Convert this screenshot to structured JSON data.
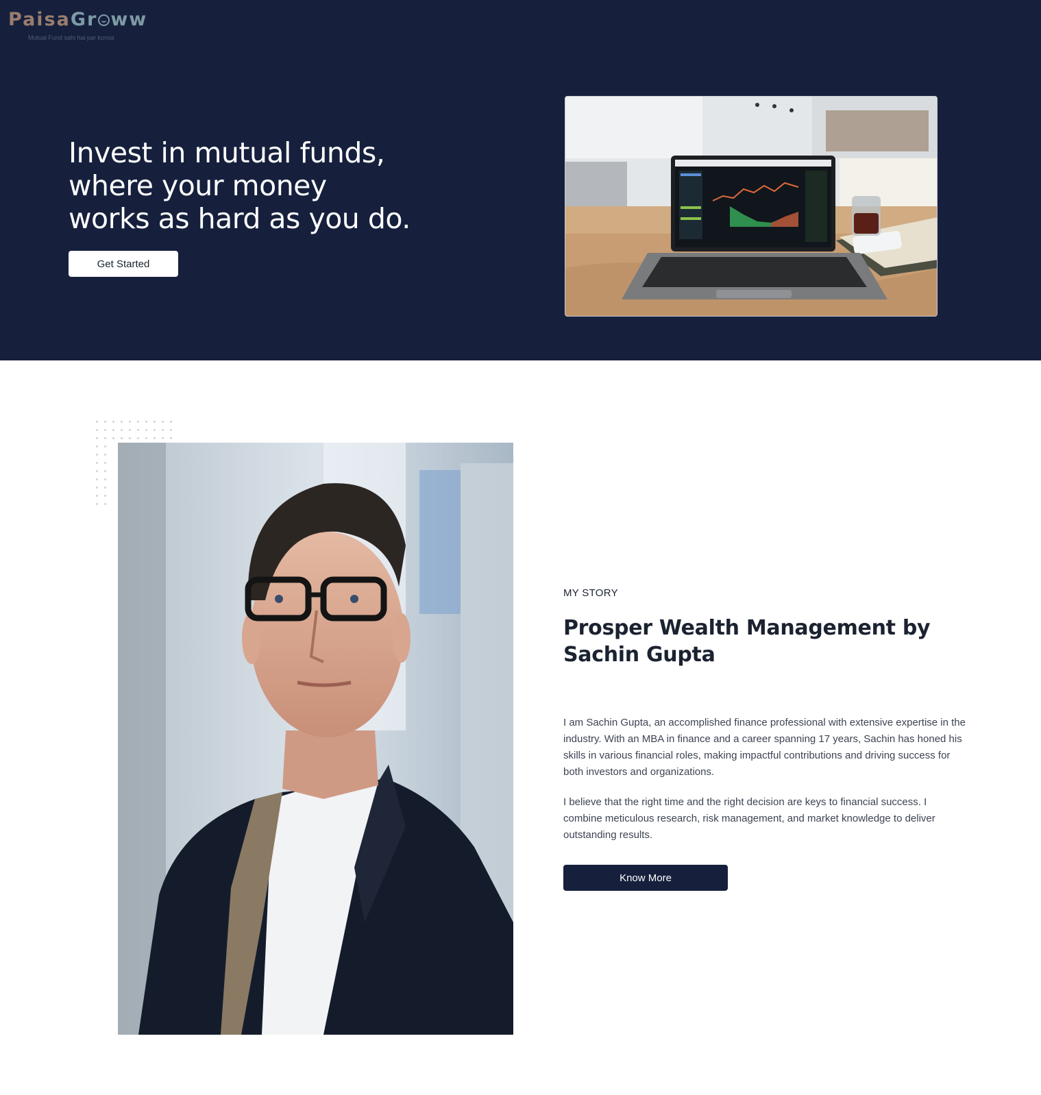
{
  "brand": {
    "name_part1": "Paisa",
    "name_part2a": "Gr",
    "name_part2b": "ww",
    "tagline": "Mutual Fund sahi hai par konsa",
    "colors": {
      "paisa": "#9a7d6e",
      "groww": "#7e9aa5"
    }
  },
  "hero": {
    "title_lines": [
      "Invest in mutual funds,",
      "where your money",
      "works as hard as you do."
    ],
    "cta_label": "Get Started",
    "image_icon": "laptop-stock-chart-photo",
    "background": "#16203d"
  },
  "story": {
    "eyebrow": "MY STORY",
    "title": "Prosper Wealth Management by Sachin Gupta",
    "paragraphs": [
      "I am Sachin Gupta, an accomplished finance professional with extensive expertise in the industry. With an MBA in finance and a career spanning 17 years, Sachin has honed his skills in various financial roles, making impactful contributions and driving success for both investors and organizations.",
      "I believe that the right time and the right decision are keys to financial success. I combine meticulous research, risk management, and market knowledge to deliver outstanding results."
    ],
    "cta_label": "Know More",
    "portrait_icon": "advisor-portrait-photo"
  }
}
